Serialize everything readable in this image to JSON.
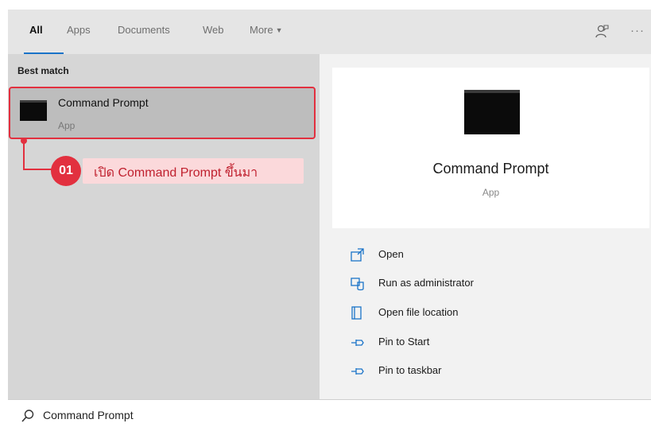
{
  "tabs": [
    {
      "label": "All"
    },
    {
      "label": "Apps"
    },
    {
      "label": "Documents"
    },
    {
      "label": "Web"
    },
    {
      "label": "More"
    }
  ],
  "header_icons": [
    "feedback-icon",
    "more-options-icon"
  ],
  "left_panel": {
    "section_title": "Best match",
    "result": {
      "title": "Command Prompt",
      "subtitle": "App",
      "icon": "command-prompt-icon"
    }
  },
  "annotation": {
    "badge": "01",
    "text": "เปิด Command Prompt ขึ้นมา"
  },
  "right_panel": {
    "app_title": "Command Prompt",
    "app_subtitle": "App",
    "actions": [
      {
        "label": "Open",
        "icon": "open-icon"
      },
      {
        "label": "Run as administrator",
        "icon": "shield-run-icon"
      },
      {
        "label": "Open file location",
        "icon": "file-location-icon"
      },
      {
        "label": "Pin to Start",
        "icon": "pin-icon"
      },
      {
        "label": "Pin to taskbar",
        "icon": "pin-icon"
      }
    ]
  },
  "search": {
    "value": "Command Prompt",
    "icon": "search-icon"
  },
  "colors": {
    "accent": "#1a73c8",
    "annotation_red": "#e2303f",
    "annotation_bg": "#fbd9db"
  }
}
